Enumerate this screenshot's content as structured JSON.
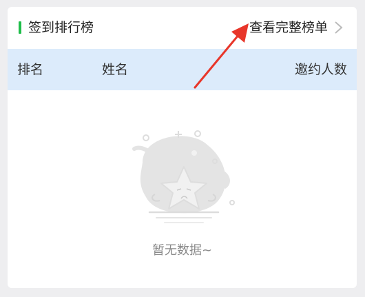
{
  "card": {
    "title": "签到排行榜",
    "view_all_label": "查看完整榜单",
    "accent_color": "#1fbe4a"
  },
  "table": {
    "columns": [
      "排名",
      "姓名",
      "邀约人数"
    ],
    "header_bg": "#dcebfb"
  },
  "empty_state": {
    "text": "暂无数据~",
    "illustration": "star-empty-illustration"
  },
  "annotation": {
    "arrow_color": "#e8362a"
  }
}
